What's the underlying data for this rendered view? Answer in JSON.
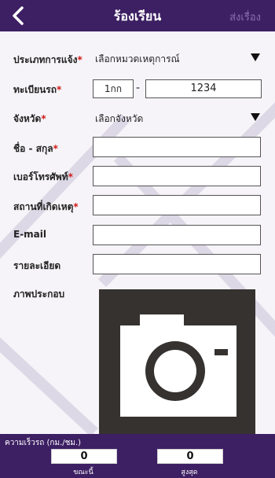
{
  "header": {
    "title": "ร้องเรียน",
    "submit_label": "ส่งเรื่อง"
  },
  "form": {
    "report_type": {
      "label": "ประเภทการแจ้ง",
      "required_mark": "*",
      "value": "เลือกหมวดเหตุการณ์"
    },
    "plate": {
      "label": "ทะเบียนรถ",
      "required_mark": "*",
      "prefix": "1กก",
      "separator": "-",
      "number": "1234"
    },
    "province": {
      "label": "จังหวัด",
      "required_mark": "*",
      "value": "เลือกจังหวัด"
    },
    "name": {
      "label": "ชื่อ - สกุล",
      "required_mark": "*",
      "value": ""
    },
    "phone": {
      "label": "เบอร์โทรศัพท์",
      "required_mark": "*",
      "value": ""
    },
    "location": {
      "label": "สถานที่เกิดเหตุ",
      "required_mark": "*",
      "value": ""
    },
    "email": {
      "label": "E-mail",
      "value": ""
    },
    "details": {
      "label": "รายละเอียด",
      "value": ""
    },
    "photo": {
      "label": "ภาพประกอบ",
      "icon": "camera-icon"
    }
  },
  "speed": {
    "title": "ความเร็วรถ (กม./ชม.)",
    "current": {
      "value": "0",
      "caption": "ขณะนี้"
    },
    "max": {
      "value": "0",
      "caption": "สูงสุด"
    }
  },
  "colors": {
    "header_bg": "#3d1f63",
    "required": "#d01818",
    "photo_bg": "#353230"
  },
  "icons": {
    "back": "back-chevron-icon",
    "dropdown": "triangle-down-icon"
  }
}
